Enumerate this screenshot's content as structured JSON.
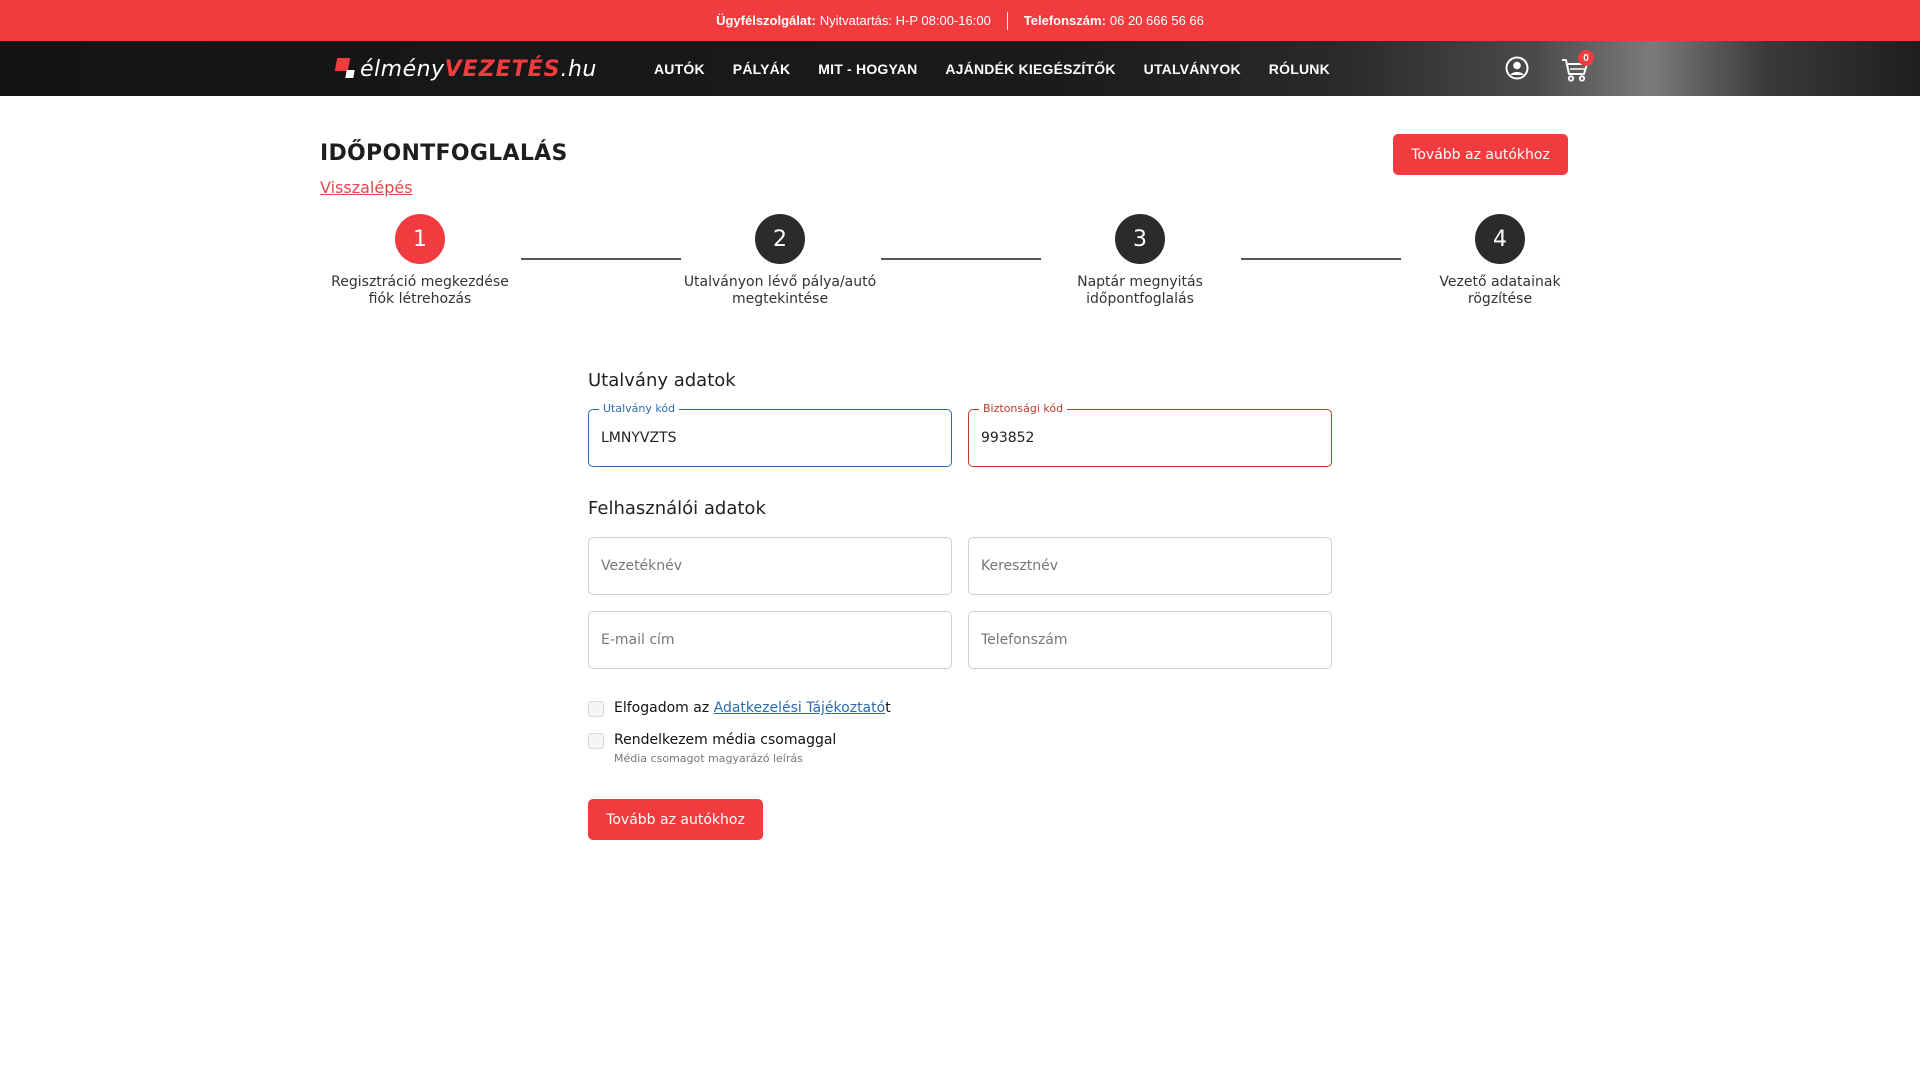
{
  "topbar": {
    "support_label": "Ügyfélszolgálat:",
    "support_value": "Nyitvatartás: H-P 08:00-16:00",
    "phone_label": "Telefonszám:",
    "phone_value": "06 20 666 56 66"
  },
  "logo": {
    "part1": "élmény",
    "part2": "VEZETÉS",
    "part3": ".hu"
  },
  "nav": {
    "items": [
      "AUTÓK",
      "PÁLYÁK",
      "MIT - HOGYAN",
      "AJÁNDÉK KIEGÉSZÍTŐK",
      "UTALVÁNYOK",
      "RÓLUNK"
    ],
    "cart_count": "0"
  },
  "page": {
    "title": "IDŐPONTFOGLALÁS",
    "back_link": "Visszalépés",
    "next_button": "Tovább az autókhoz"
  },
  "steps": [
    {
      "number": "1",
      "line1": "Regisztráció megkezdése",
      "line2": "fiók létrehozás"
    },
    {
      "number": "2",
      "line1": "Utalványon lévő pálya/autó",
      "line2": "megtekintése"
    },
    {
      "number": "3",
      "line1": "Naptár megnyitás",
      "line2": "időpontfoglalás"
    },
    {
      "number": "4",
      "line1": "Vezető adatainak",
      "line2": "rögzítése"
    }
  ],
  "voucher": {
    "title": "Utalvány adatok",
    "code_label": "Utalvány kód",
    "code_value": "LMNYVZTS",
    "security_label": "Biztonsági kód",
    "security_value": "993852"
  },
  "user": {
    "title": "Felhasználói adatok",
    "lastname_placeholder": "Vezetéknév",
    "firstname_placeholder": "Keresztnév",
    "email_placeholder": "E-mail cím",
    "phone_placeholder": "Telefonszám"
  },
  "consent": {
    "privacy_prefix": "Elfogadom az ",
    "privacy_link": "Adatkezelési Tájékoztató",
    "privacy_suffix": "t",
    "media_label": "Rendelkezem média csomaggal",
    "media_desc": "Média csomagot magyarázó leírás"
  },
  "submit_button": "Tovább az autókhoz",
  "colors": {
    "brand_red": "#f23b3f",
    "focus_blue": "#2c6cb0",
    "error_red": "#c0392b",
    "step_dark": "#2b2b2b"
  }
}
